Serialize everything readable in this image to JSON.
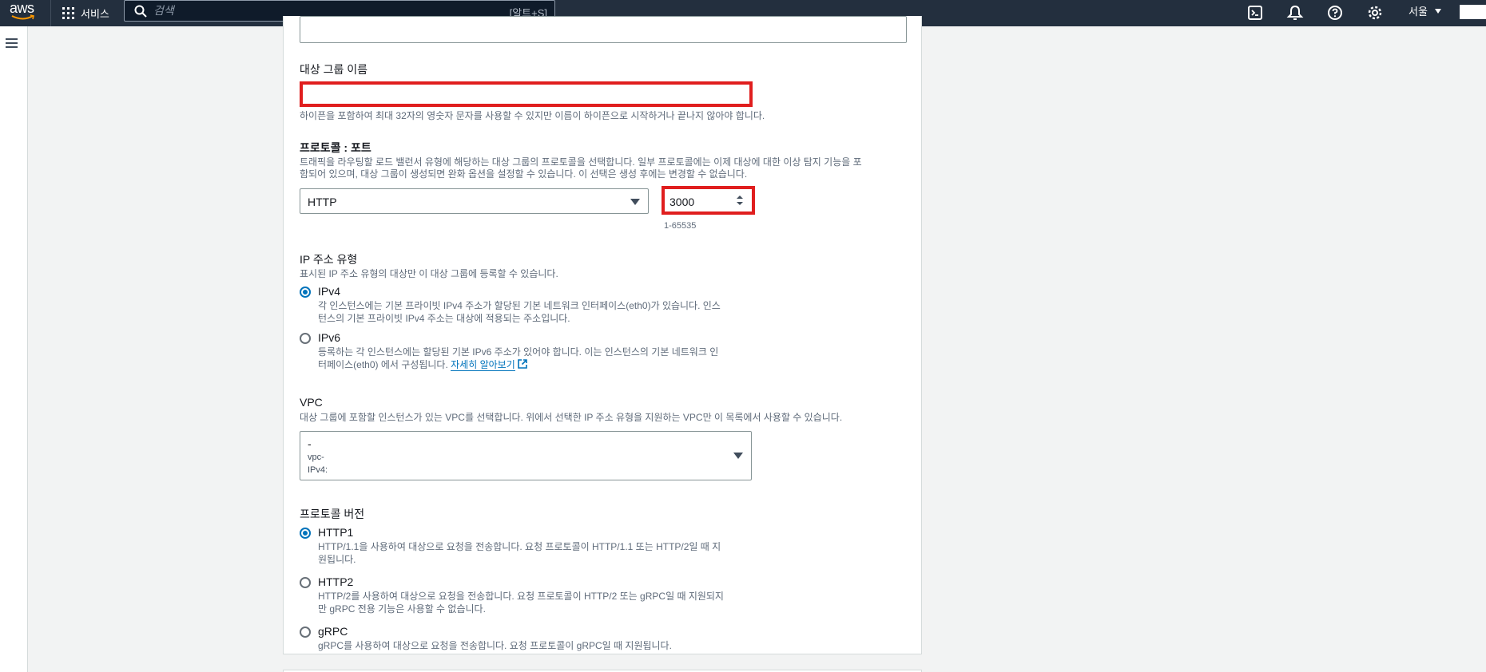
{
  "topnav": {
    "logo_text": "aws",
    "services_label": "서비스",
    "search_placeholder": "검색",
    "search_shortcut": "[알트+S]",
    "region_label": "서울",
    "icons": [
      "cloudshell-icon",
      "notifications-icon",
      "help-icon",
      "settings-icon"
    ]
  },
  "form": {
    "target_group_name": {
      "label": "대상 그룹 이름",
      "value": "",
      "hint": "하이픈을 포함하여 최대 32자의 영숫자 문자를 사용할 수 있지만 이름이 하이픈으로 시작하거나 끝나지 않아야 합니다."
    },
    "protocol_port": {
      "label": "프로토콜 : 포트",
      "desc_line1": "트래픽을 라우팅할 로드 밸런서 유형에 해당하는 대상 그룹의 프로토콜을 선택합니다. 일부 프로토콜에는 이제 대상에 대한 이상 탐지 기능을 포",
      "desc_line2": "함되어 있으며, 대상 그룹이 생성되면 완화 옵션을 설정할 수 있습니다. 이 선택은 생성 후에는 변경할 수 없습니다.",
      "protocol_value": "HTTP",
      "port_value": "3000",
      "port_hint": "1-65535"
    },
    "ip_type": {
      "label": "IP 주소 유형",
      "desc": "표시된 IP 주소 유형의 대상만 이 대상 그룹에 등록할 수 있습니다.",
      "options": [
        {
          "label": "IPv4",
          "selected": true,
          "desc_line1": "각 인스턴스에는 기본 프라이빗 IPv4 주소가 할당된 기본 네트워크 인터페이스(eth0)가 있습니다. 인스",
          "desc_line2": "턴스의 기본 프라이빗 IPv4 주소는 대상에 적용되는 주소입니다."
        },
        {
          "label": "IPv6",
          "selected": false,
          "desc_line1": "등록하는 각 인스턴스에는 할당된 기본 IPv6 주소가 있어야 합니다. 이는 인스턴스의 기본 네트워크 인",
          "desc_line2": "터페이스(eth0) 에서 구성됩니다.",
          "link": "자세히 알아보기"
        }
      ]
    },
    "vpc": {
      "label": "VPC",
      "desc": "대상 그룹에 포함할 인스턴스가 있는 VPC를 선택합니다. 위에서 선택한 IP 주소 유형을 지원하는 VPC만 이 목록에서 사용할 수 있습니다.",
      "value_name": "-",
      "value_id": "vpc-",
      "value_ipv4": "IPv4:"
    },
    "protocol_version": {
      "label": "프로토콜 버전",
      "options": [
        {
          "label": "HTTP1",
          "selected": true,
          "desc_line1": "HTTP/1.1을 사용하여 대상으로 요청을 전송합니다. 요청 프로토콜이 HTTP/1.1 또는 HTTP/2일 때 지",
          "desc_line2": "원됩니다."
        },
        {
          "label": "HTTP2",
          "selected": false,
          "desc_line1": "HTTP/2를 사용하여 대상으로 요청을 전송합니다. 요청 프로토콜이 HTTP/2 또는 gRPC일 때 지원되지",
          "desc_line2": "만 gRPC 전용 기능은 사용할 수 없습니다."
        },
        {
          "label": "gRPC",
          "selected": false,
          "desc_line1": "gRPC를 사용하여 대상으로 요청을 전송합니다. 요청 프로토콜이 gRPC일 때 지원됩니다.",
          "desc_line2": ""
        }
      ]
    }
  },
  "colors": {
    "nav_bg": "#232f3e",
    "highlight": "#e01e1e",
    "accent": "#0073bb"
  }
}
